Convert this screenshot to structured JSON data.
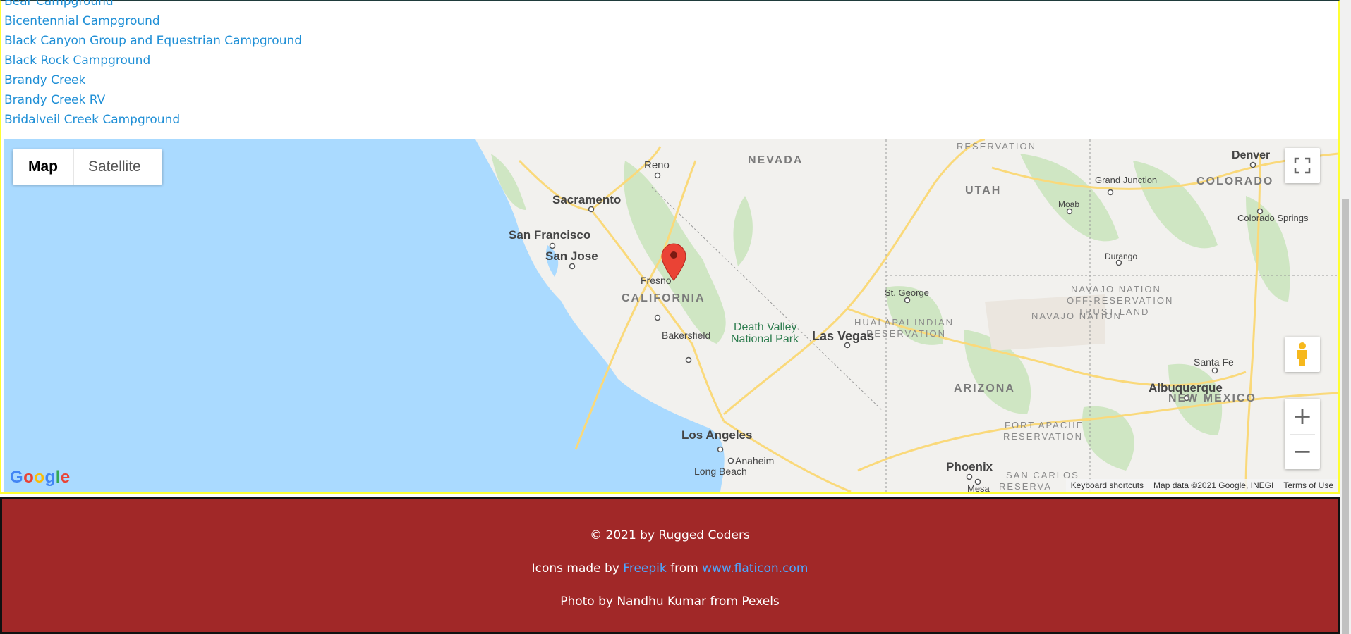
{
  "campgrounds": [
    "Bear Campground",
    "Bicentennial Campground",
    "Black Canyon Group and Equestrian Campground",
    "Black Rock Campground",
    "Brandy Creek",
    "Brandy Creek RV",
    "Bridalveil Creek Campground"
  ],
  "map": {
    "type_control": {
      "map": "Map",
      "satellite": "Satellite",
      "active": "Map"
    },
    "labels": {
      "cities": [
        "Reno",
        "Sacramento",
        "San Francisco",
        "San Jose",
        "Fresno",
        "Bakersfield",
        "Los Angeles",
        "Anaheim",
        "Long Beach",
        "Las Vegas",
        "St. George",
        "Denver",
        "Grand Junction",
        "Moab",
        "Colorado Springs",
        "Durango",
        "Santa Fe",
        "Albuquerque",
        "Phoenix",
        "Mesa"
      ],
      "states": [
        "NEVADA",
        "UTAH",
        "COLORADO",
        "CALIFORNIA",
        "ARIZONA",
        "NEW MEXICO"
      ],
      "reservations": [
        "RESERVATION",
        "HUALAPAI INDIAN",
        "NAVAJO NATION",
        "OFF-RESERVATION",
        "TRUST LAND",
        "FORT APACHE",
        "SAN CARLOS",
        "RESERVA"
      ],
      "park_line1": "Death Valley",
      "park_line2": "National Park"
    },
    "attribution": {
      "shortcuts": "Keyboard shortcuts",
      "data": "Map data ©2021 Google, INEGI",
      "terms": "Terms of Use"
    },
    "logo": "Google",
    "colors": {
      "water": "#aadaff",
      "land": "#f2f1ee",
      "forest": "#cfe6c3",
      "marker": "#ea4335",
      "roads": "#fad97a"
    }
  },
  "footer": {
    "copyright": "© 2021 by Rugged Coders",
    "icons_prefix": "Icons made by",
    "icons_author": "Freepik",
    "icons_from": "from",
    "icons_site": "www.flaticon.com",
    "photo": "Photo by Nandhu Kumar from Pexels"
  }
}
